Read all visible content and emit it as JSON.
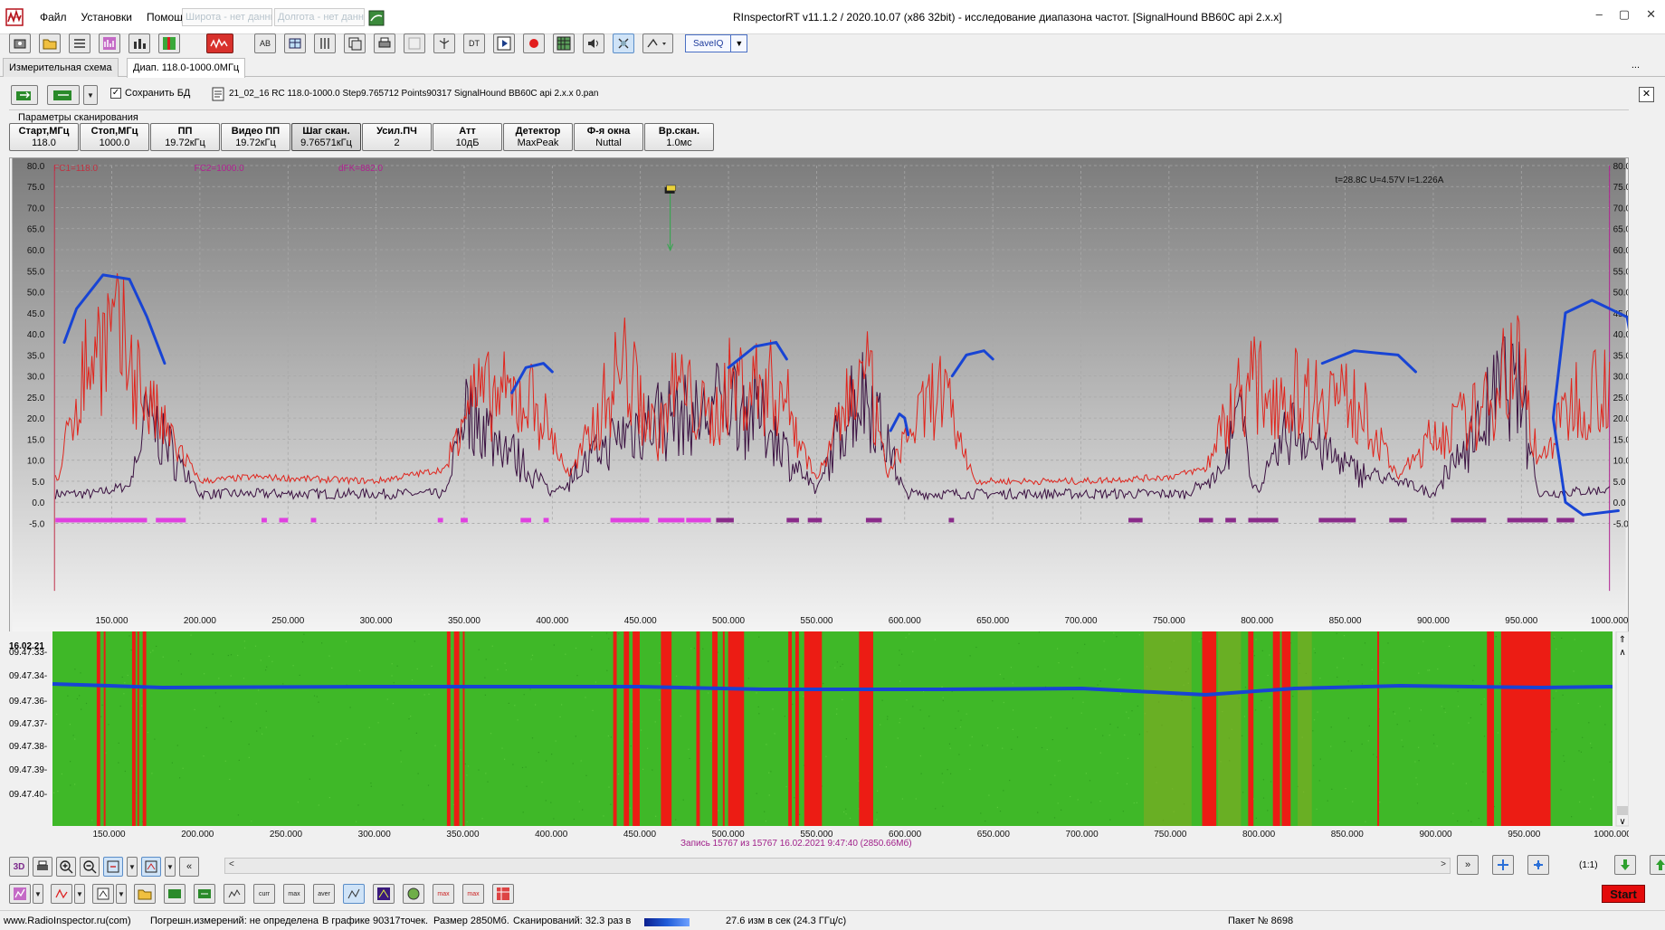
{
  "window": {
    "title": "RInspectorRT v11.1.2 / 2020.10.07 (x86 32bit) - исследование диапазона частот. [SignalHound BB60C api 2.x.x]",
    "controls": [
      "–",
      "▢",
      "✕"
    ]
  },
  "menu": [
    "Файл",
    "Установки",
    "Помощь"
  ],
  "coords": {
    "lat": "Широта - нет данных",
    "lon": "Долгота - нет данных"
  },
  "toolbar": {
    "save_iq": "SaveIQ",
    "dt_label": "DT",
    "ab_label": "AB"
  },
  "tabs": [
    "Измерительная схема",
    "Диап. 118.0-1000.0МГц"
  ],
  "tab_more": "...",
  "toolbar2": {
    "save_db_label": "Сохранить БД",
    "save_db_checked": "✓",
    "file_info": "21_02_16 RC 118.0-1000.0 Step9.765712 Points90317 SignalHound BB60C api 2.x.x 0.pan"
  },
  "scan_params": {
    "title": "Параметры сканирования",
    "buttons": [
      {
        "label": "Старт,МГц",
        "value": "118.0"
      },
      {
        "label": "Стоп,МГц",
        "value": "1000.0"
      },
      {
        "label": "ПП",
        "value": "19.72кГц"
      },
      {
        "label": "Видео ПП",
        "value": "19.72кГц"
      },
      {
        "label": "Шаг скан.",
        "value": "9.76571кГц"
      },
      {
        "label": "Усил.ПЧ",
        "value": "2"
      },
      {
        "label": "Атт",
        "value": "10дБ"
      },
      {
        "label": "Детектор",
        "value": "MaxPeak"
      },
      {
        "label": "Ф-я окна",
        "value": "Nuttal"
      },
      {
        "label": "Вр.скан.",
        "value": "1.0мс"
      }
    ]
  },
  "spectrum": {
    "fc1": "FC1=118.0",
    "fc2": "FC2=1000.0",
    "dfk": "dFK=882.0",
    "status": "t=28.8C U=4.57V I=1.226A",
    "y_ticks": [
      "80.0",
      "75.0",
      "70.0",
      "65.0",
      "60.0",
      "55.0",
      "50.0",
      "45.0",
      "40.0",
      "35.0",
      "30.0",
      "25.0",
      "20.0",
      "15.0",
      "10.0",
      "5.0",
      "0.0",
      "-5.0"
    ],
    "x_ticks": [
      "150.000",
      "200.000",
      "250.000",
      "300.000",
      "350.000",
      "400.000",
      "450.000",
      "500.000",
      "550.000",
      "600.000",
      "650.000",
      "700.000",
      "750.000",
      "800.000",
      "850.000",
      "900.000",
      "950.000",
      "1000.000"
    ],
    "colors": {
      "trace_max": "#e0241c",
      "trace_cur": "#3a1040",
      "annotation": "#1844d4",
      "bg_top": "#7c7c7c",
      "bg_bottom": "#f4f4f4"
    }
  },
  "chart_data": {
    "type": "line",
    "title": "",
    "xlabel": "",
    "ylabel": "",
    "xlim": [
      118.0,
      1000.0
    ],
    "ylim": [
      -5.0,
      80.0
    ],
    "grid": true,
    "series": [
      {
        "name": "",
        "x": [
          120,
          130,
          140,
          150,
          160,
          170,
          180,
          200,
          230,
          300,
          340,
          350,
          390,
          410,
          440,
          460,
          470,
          490,
          500,
          510,
          530,
          550,
          570,
          580,
          590,
          600,
          620,
          640,
          700,
          750,
          770,
          790,
          800,
          820,
          840,
          860,
          880,
          900,
          930,
          940,
          950,
          960,
          980,
          1000
        ],
        "values": [
          6,
          30,
          45,
          47,
          42,
          28,
          20,
          5,
          6,
          5,
          8,
          30,
          29,
          6,
          40,
          18,
          34,
          22,
          33,
          34,
          32,
          5,
          32,
          34,
          6,
          17,
          32,
          5,
          5,
          6,
          8,
          32,
          33,
          30,
          32,
          26,
          6,
          18,
          26,
          40,
          38,
          10,
          30,
          35
        ]
      },
      {
        "name": "",
        "x": [
          120,
          140,
          160,
          170,
          200,
          300,
          340,
          350,
          400,
          440,
          460,
          480,
          500,
          520,
          550,
          570,
          580,
          600,
          620,
          700,
          760,
          780,
          790,
          800,
          820,
          850,
          900,
          930,
          940,
          950,
          960,
          1000
        ],
        "values": [
          2,
          2,
          4,
          25,
          2,
          2,
          2,
          28,
          2,
          20,
          25,
          24,
          30,
          24,
          2,
          30,
          32,
          2,
          2,
          2,
          2,
          8,
          25,
          2,
          22,
          10,
          2,
          25,
          35,
          30,
          2,
          3
        ]
      }
    ]
  },
  "waterfall": {
    "date": "16.02.21",
    "times": [
      "09.47.33-",
      "09.47.34-",
      "09.47.36-",
      "09.47.37-",
      "09.47.38-",
      "09.47.39-",
      "09.47.40-"
    ],
    "x_ticks": [
      "150.000",
      "200.000",
      "250.000",
      "300.000",
      "350.000",
      "400.000",
      "450.000",
      "500.000",
      "550.000",
      "600.000",
      "650.000",
      "700.000",
      "750.000",
      "800.000",
      "850.000",
      "900.000",
      "950.000",
      "1000.000"
    ],
    "record_info": "Запись 15767  из 15767   16.02.2021 9:47:40 (2850.66Мб)"
  },
  "nav": {
    "left_label": "3D",
    "ratio_label": "(1:1)",
    "start_label": "Start"
  },
  "statusbar": {
    "site": "www.RadioInspector.ru(com)",
    "error": "Погрешн.измерений: не определена",
    "points": "В графике 90317точек.",
    "size": "Размер 2850Мб.",
    "scans": "Сканирований: 32.3 раз в",
    "rate": "27.6 изм в сек (24.3 ГГц/с)",
    "packet": "Пакет № 8698"
  }
}
